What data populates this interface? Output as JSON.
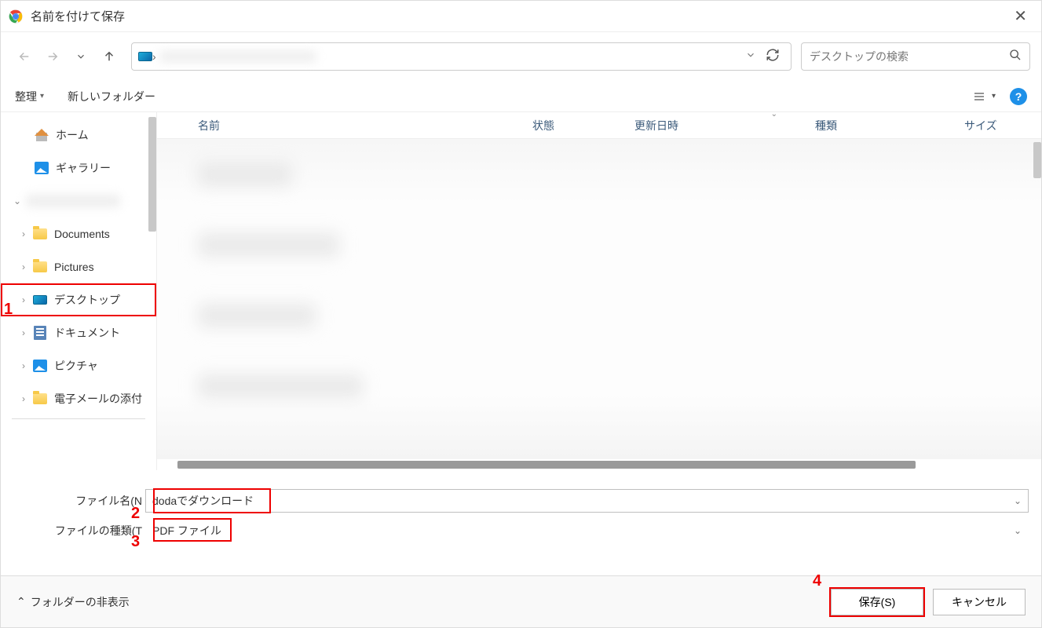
{
  "titlebar": {
    "title": "名前を付けて保存"
  },
  "addressbar": {
    "path": "›"
  },
  "search": {
    "placeholder": "デスクトップの検索"
  },
  "toolbar": {
    "organize": "整理",
    "new_folder": "新しいフォルダー"
  },
  "sidebar": {
    "home": "ホーム",
    "gallery": "ギャラリー",
    "documents": "Documents",
    "pictures": "Pictures",
    "desktop": "デスクトップ",
    "docs_jp": "ドキュメント",
    "pics_jp": "ピクチャ",
    "email": "電子メールの添付"
  },
  "columns": {
    "name": "名前",
    "state": "状態",
    "date": "更新日時",
    "type": "種類",
    "size": "サイズ"
  },
  "inputs": {
    "filename_label": "ファイル名(N",
    "filename_value": "dodaでダウンロード",
    "filetype_label": "ファイルの種類(T",
    "filetype_value": "PDF ファイル"
  },
  "footer": {
    "hide_folders": "フォルダーの非表示",
    "save": "保存(S)",
    "cancel": "キャンセル"
  },
  "annotations": {
    "a1": "1",
    "a2": "2",
    "a3": "3",
    "a4": "4"
  }
}
